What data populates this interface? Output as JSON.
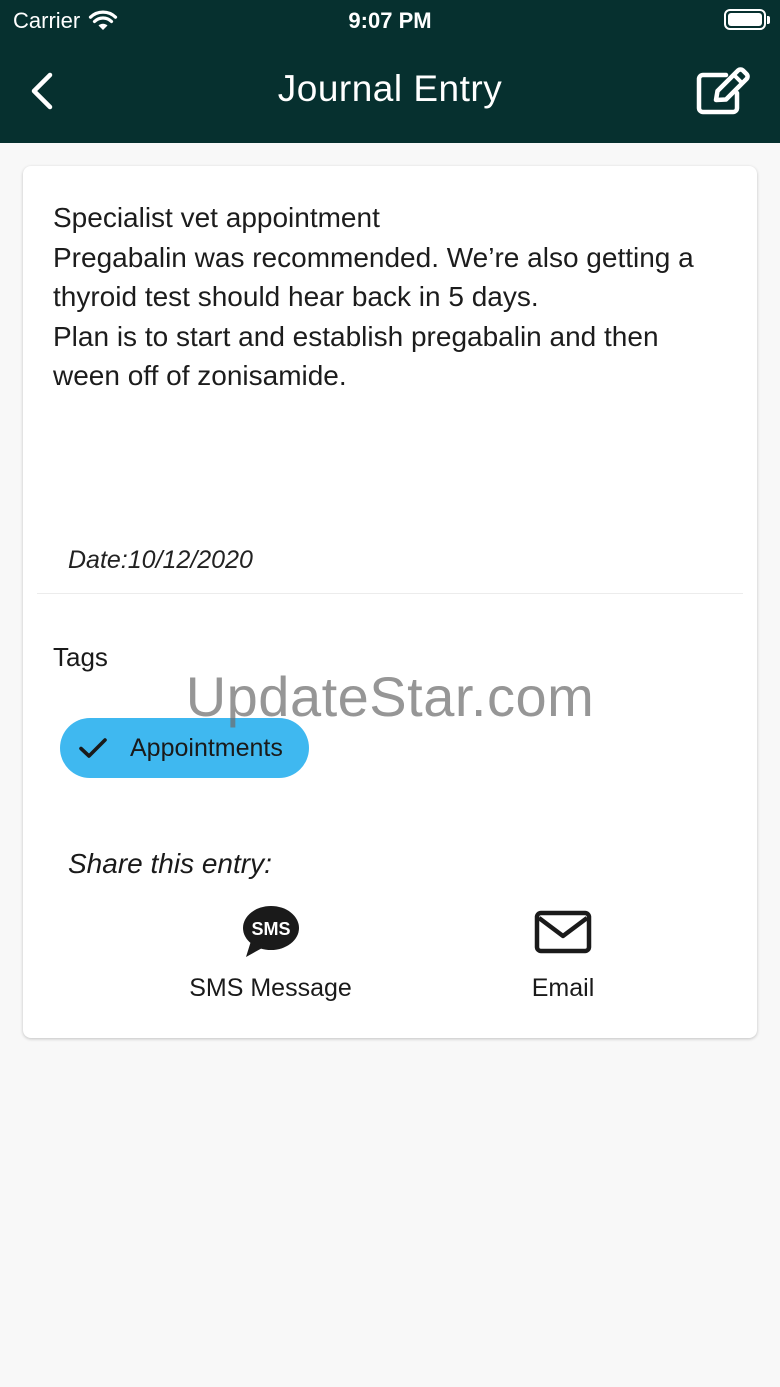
{
  "status_bar": {
    "carrier": "Carrier",
    "time": "9:07 PM"
  },
  "nav": {
    "title": "Journal Entry",
    "back_icon": "chevron-left-icon",
    "edit_icon": "edit-icon"
  },
  "entry": {
    "text": "Specialist vet appointment\nPregabalin was recommended. We’re also getting a thyroid test should hear back in 5 days.\nPlan is to start and establish pregabalin and then ween off of zonisamide.",
    "date_label": "Date:",
    "date_value": "10/12/2020"
  },
  "tags": {
    "title": "Tags",
    "items": [
      {
        "label": "Appointments",
        "selected": true,
        "color": "#3fb8f0"
      }
    ]
  },
  "share": {
    "title": "Share this entry:",
    "options": [
      {
        "label": "SMS Message",
        "icon": "sms-icon",
        "icon_text": "SMS"
      },
      {
        "label": "Email",
        "icon": "envelope-icon"
      }
    ]
  },
  "watermark": "UpdateStar.com",
  "colors": {
    "header_bg": "#06302f",
    "chip_bg": "#3fb8f0",
    "page_bg": "#f8f8f8"
  }
}
